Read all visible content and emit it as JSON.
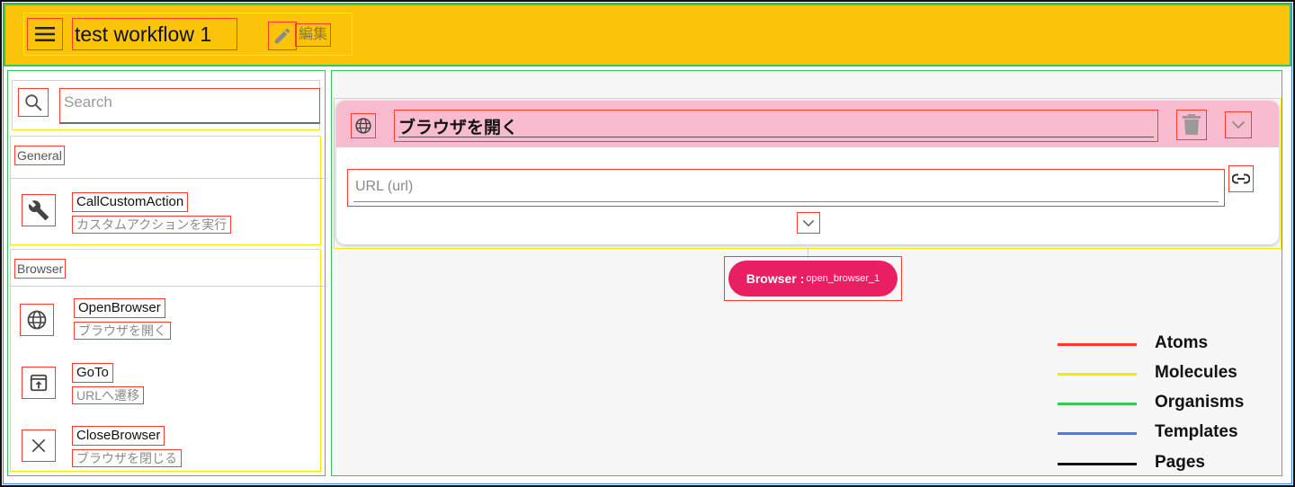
{
  "header": {
    "title": "test workflow 1",
    "edit_label": "編集"
  },
  "sidebar": {
    "search": {
      "placeholder": "Search"
    },
    "groups": [
      {
        "label": "General",
        "items": [
          {
            "name": "CallCustomAction",
            "description": "カスタムアクションを実行",
            "icon": "wrench-icon"
          }
        ]
      },
      {
        "label": "Browser",
        "items": [
          {
            "name": "OpenBrowser",
            "description": "ブラウザを開く",
            "icon": "globe-icon"
          },
          {
            "name": "GoTo",
            "description": "URLへ遷移",
            "icon": "open-in-browser-icon"
          },
          {
            "name": "CloseBrowser",
            "description": "ブラウザを閉じる",
            "icon": "close-icon"
          }
        ]
      }
    ]
  },
  "workflow": {
    "node": {
      "title": "ブラウザを開く",
      "icon": "globe-icon",
      "url_placeholder": "URL (url)"
    },
    "output_badge": {
      "label": "Browser :",
      "value": "open_browser_1"
    }
  },
  "legend": [
    {
      "label": "Atoms",
      "color": "#ff3b30"
    },
    {
      "label": "Molecules",
      "color": "#ffe600"
    },
    {
      "label": "Organisms",
      "color": "#34c759"
    },
    {
      "label": "Templates",
      "color": "#3b82f6"
    },
    {
      "label": "Pages",
      "color": "#111111"
    }
  ],
  "colors": {
    "header_bg": "#fbc40a",
    "node_header_bg": "#f8bbd0",
    "badge_bg": "#e91e63"
  }
}
